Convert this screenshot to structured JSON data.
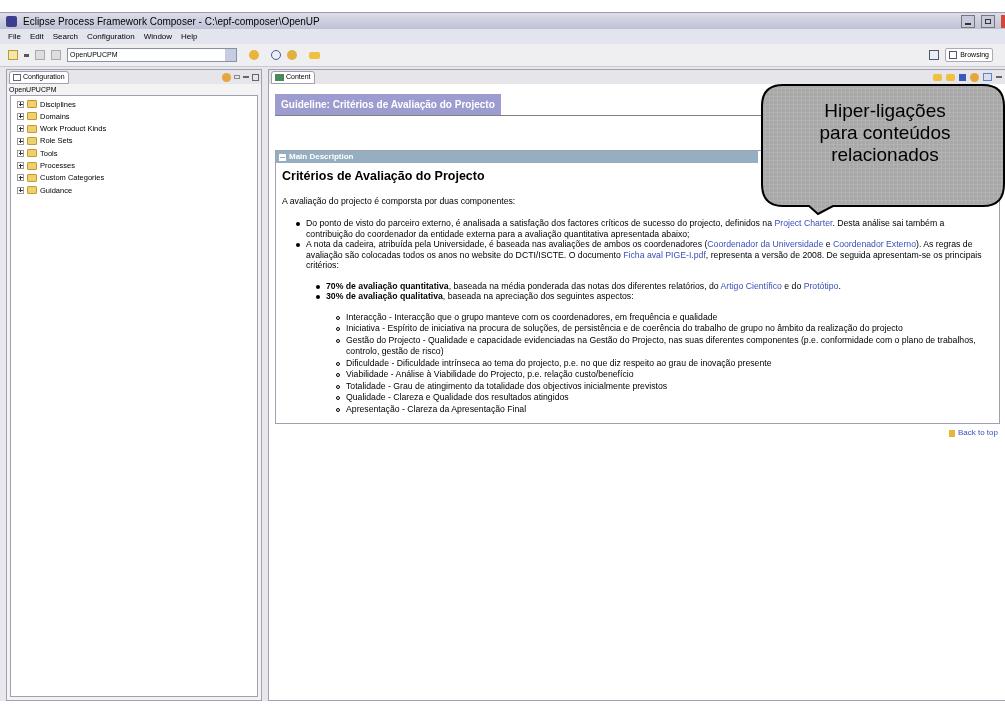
{
  "window": {
    "title": "Eclipse Process Framework Composer - C:\\epf-composer\\OpenUP"
  },
  "menu": [
    "File",
    "Edit",
    "Search",
    "Configuration",
    "Window",
    "Help"
  ],
  "toolbar": {
    "configuration_combo": "OpenUPUCPM",
    "perspective": "Browsing"
  },
  "configuration_view": {
    "tab": "Configuration",
    "name": "OpenUPUCPM",
    "tree": [
      {
        "label": "Disciplines",
        "expanded": false
      },
      {
        "label": "Domains",
        "expanded": false
      },
      {
        "label": "Work Product Kinds",
        "expanded": false
      },
      {
        "label": "Role Sets",
        "expanded": false
      },
      {
        "label": "Tools",
        "expanded": false
      },
      {
        "label": "Processes",
        "expanded": false
      },
      {
        "label": "Custom Categories",
        "expanded": false
      },
      {
        "label": "Guidance",
        "expanded": false
      }
    ]
  },
  "content_view": {
    "tab": "Content",
    "page_title": "Guideline: Critérios de Avaliação do Projecto",
    "section": {
      "title": "Main Description",
      "expanded": true,
      "heading": "Critérios de Avaliação do Projecto",
      "intro": "A avaliação do projecto é comporsta por duas componentes:",
      "items": [
        [
          {
            "kind": "text",
            "text": "Do ponto de visto do parceiro externo, é analisada a satisfação dos factores críticos de sucesso do projecto, definidos na "
          },
          {
            "kind": "link",
            "text": "Project Charter"
          },
          {
            "kind": "text",
            "text": ". Desta análise sai também a contribuição do coordenador da entidade externa para a avaliação quantitativa apresentada abaixo;"
          }
        ],
        [
          {
            "kind": "text",
            "text": "A nota da cadeira, atribuída pela Universidade, é baseada nas avaliações de ambos os coordenadores ("
          },
          {
            "kind": "link",
            "text": "Coordenador da Universidade"
          },
          {
            "kind": "text",
            "text": " e "
          },
          {
            "kind": "link",
            "text": "Coordenador Externo"
          },
          {
            "kind": "text",
            "text": "). As regras de avaliação são colocadas todos os anos no website do DCTI/ISCTE. O documento "
          },
          {
            "kind": "link",
            "text": "Ficha aval PIGE-I.pdf"
          },
          {
            "kind": "text",
            "text": ", representa a versão de 2008. De seguida apresentam-se os principais critérios:"
          }
        ]
      ],
      "criteria": [
        [
          {
            "kind": "bold",
            "text": "70% de avaliação quantitativa"
          },
          {
            "kind": "text",
            "text": ", baseada na média ponderada das notas dos diferentes relatórios, do "
          },
          {
            "kind": "link",
            "text": "Artigo Científico"
          },
          {
            "kind": "text",
            "text": " e do "
          },
          {
            "kind": "link",
            "text": "Protótipo"
          },
          {
            "kind": "text",
            "text": "."
          }
        ],
        [
          {
            "kind": "bold",
            "text": "30% de avaliação qualitativa"
          },
          {
            "kind": "text",
            "text": ", baseada na apreciação dos seguintes aspectos:"
          }
        ]
      ],
      "aspects": [
        "Interacção - Interacção que o grupo manteve com os coordenadores, em frequência e qualidade",
        "Iniciativa - Espírito de iniciativa na procura de soluções, de persistência e de coerência do trabalho de grupo no âmbito da realização do projecto",
        "Gestão do Projecto - Qualidade e capacidade evidenciadas na Gestão do Projecto, nas suas diferentes componentes (p.e. conformidade com o plano de trabalhos, controlo, gestão de risco)",
        "Dificuldade - Dificuldade intrínseca ao tema do projecto, p.e. no que diz respeito ao grau de inovação presente",
        "Viabilidade - Análise à Viabilidade do Projecto, p.e. relação custo/benefício",
        "Totalidade - Grau de atingimento da totalidade dos objectivos inicialmente previstos",
        "Qualidade - Clareza e Qualidade dos resultados atingidos",
        "Apresentação - Clareza da Apresentação Final"
      ]
    },
    "back_to_top": "Back to top"
  },
  "callout": {
    "text": "Hiper-ligações para conteúdos relacionados"
  }
}
